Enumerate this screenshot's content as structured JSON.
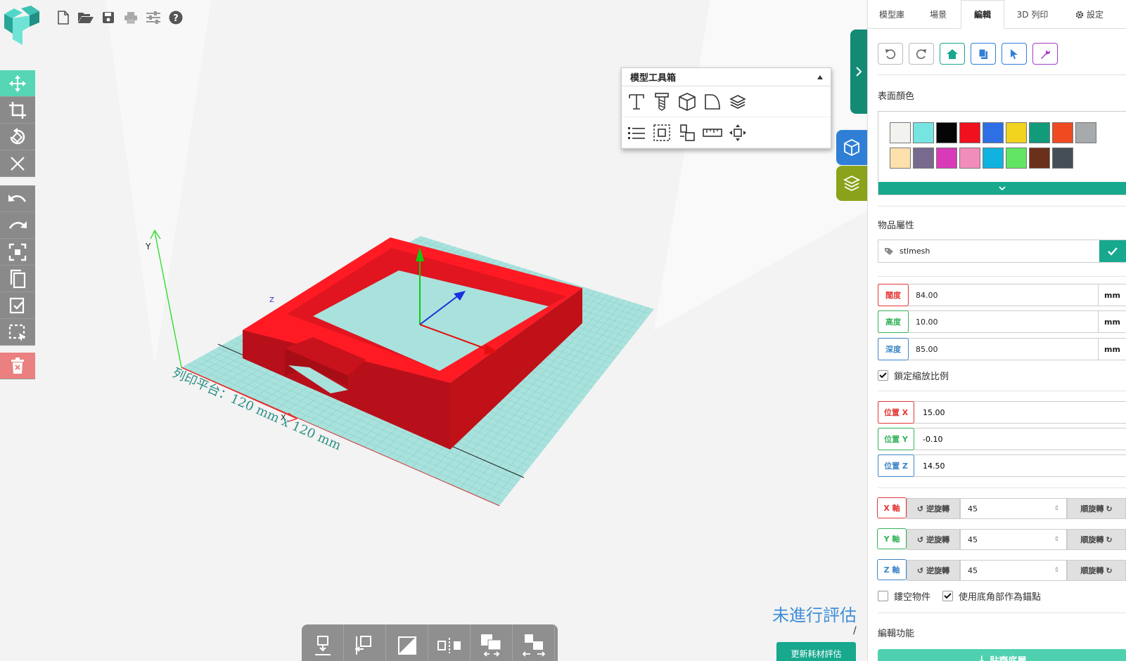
{
  "toolbox": {
    "title": "模型工具箱"
  },
  "scene": {
    "axis_y": "Y",
    "axis_z": "Z",
    "axis_x": "X",
    "platform_label": "列印平台：120 mm x 120 mm",
    "model_color": "#ff1a24",
    "grid_color": "#a6e3df"
  },
  "status": {
    "evaluation": "未進行評估",
    "slash": "/",
    "update_button": "更新耗材評估"
  },
  "tabs": [
    {
      "label": "模型庫"
    },
    {
      "label": "場景"
    },
    {
      "label": "編輯"
    },
    {
      "label": "3D 列印"
    },
    {
      "label": "設定"
    }
  ],
  "surface_color": {
    "label": "表面顏色",
    "swatches": [
      "#f2f3ee",
      "#76e5e1",
      "#050505",
      "#f0101e",
      "#2f6fe6",
      "#f2d41e",
      "#129b7b",
      "#ef4a20",
      "#a6aaad",
      "#fde0ab",
      "#786a8f",
      "#d83ab8",
      "#f28dbb",
      "#10b2df",
      "#62e562",
      "#6a3019",
      "#454e57"
    ]
  },
  "properties": {
    "label": "物品屬性",
    "name": "stlmesh",
    "width_label": "闊度",
    "width": "84.00",
    "height_label": "高度",
    "height": "10.00",
    "depth_label": "深度",
    "depth": "85.00",
    "unit": "mm",
    "lock_ratio": "鎖定縮放比例",
    "pos_x_label": "位置 X",
    "pos_x": "15.00",
    "pos_y_label": "位置 Y",
    "pos_y": "-0.10",
    "pos_z_label": "位置 Z",
    "pos_z": "14.50",
    "x_axis": "X 軸",
    "y_axis": "Y 軸",
    "z_axis": "Z 軸",
    "ccw": "逆旋轉",
    "cw": "順旋轉",
    "rot_x": "45",
    "rot_y": "45",
    "rot_z": "45",
    "hollow": "鏤空物件",
    "use_corner": "使用底角部作為錨點"
  },
  "edit": {
    "label": "編輯功能",
    "button": "貼齊底層"
  }
}
